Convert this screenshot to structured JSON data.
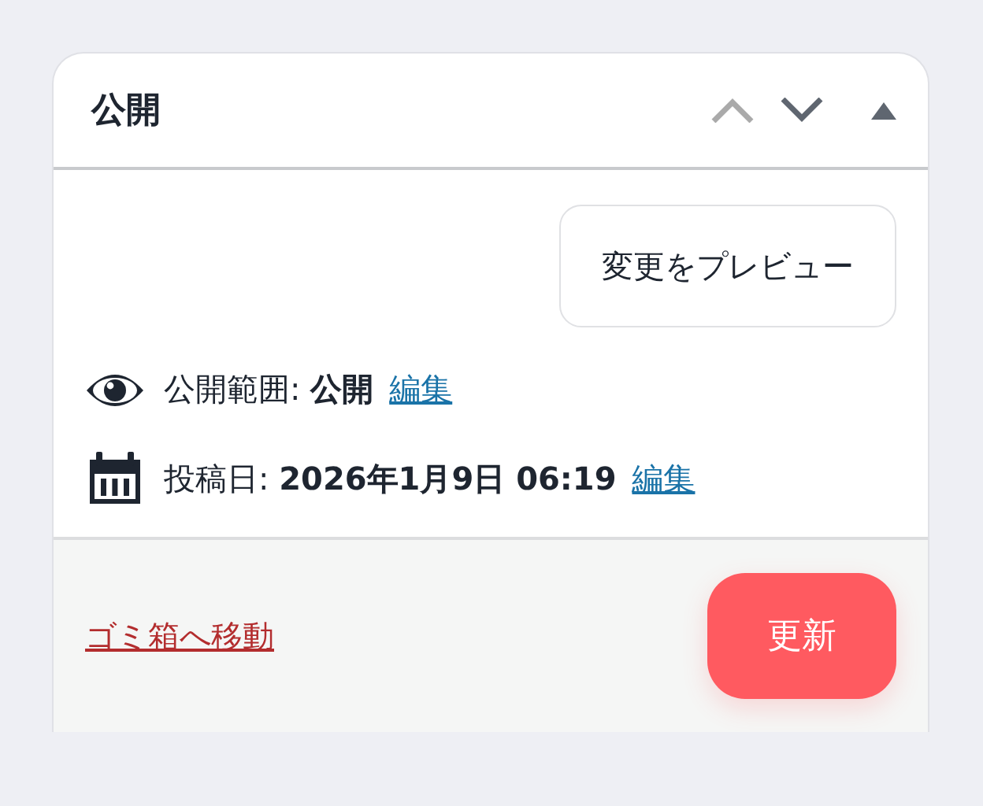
{
  "panel": {
    "title": "公開",
    "expanded": true,
    "move_buttons": [
      {
        "kind": "up",
        "disabled": true
      },
      {
        "kind": "down",
        "disabled": false
      }
    ]
  },
  "preview_button": "変更をプレビュー",
  "rows": [
    {
      "kind": "visibility",
      "text": "公開範囲: **公開**",
      "link": "編集"
    },
    {
      "kind": "date",
      "text": "投稿日: **2026年1月9日 06:19**",
      "link": "編集"
    }
  ],
  "footer": {
    "trash_link": "ゴミ箱へ移動",
    "update_button": "更新"
  }
}
